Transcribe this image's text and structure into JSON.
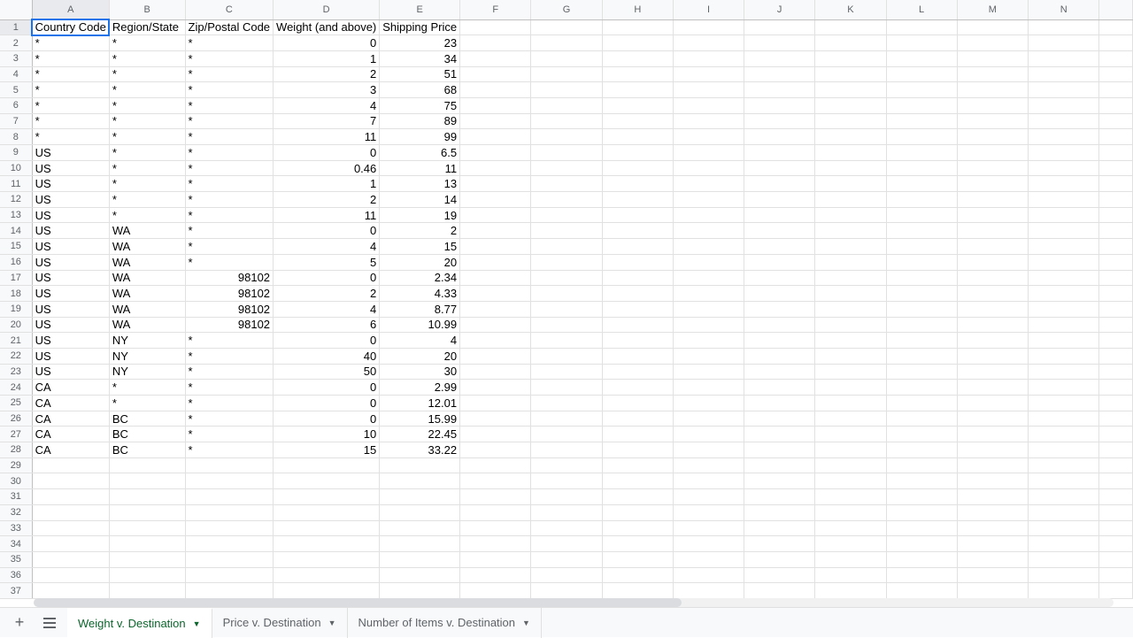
{
  "columns": [
    "A",
    "B",
    "C",
    "D",
    "E",
    "F",
    "G",
    "H",
    "I",
    "J",
    "K",
    "L",
    "M",
    "N"
  ],
  "headers": [
    "Country Code",
    "Region/State",
    "Zip/Postal Code",
    "Weight (and above)",
    "Shipping Price"
  ],
  "activeCell": "A1",
  "rows": [
    [
      "*",
      "*",
      "*",
      "0",
      "23"
    ],
    [
      "*",
      "*",
      "*",
      "1",
      "34"
    ],
    [
      "*",
      "*",
      "*",
      "2",
      "51"
    ],
    [
      "*",
      "*",
      "*",
      "3",
      "68"
    ],
    [
      "*",
      "*",
      "*",
      "4",
      "75"
    ],
    [
      "*",
      "*",
      "*",
      "7",
      "89"
    ],
    [
      "*",
      "*",
      "*",
      "11",
      "99"
    ],
    [
      "US",
      "*",
      "*",
      "0",
      "6.5"
    ],
    [
      "US",
      "*",
      "*",
      "0.46",
      "11"
    ],
    [
      "US",
      "*",
      "*",
      "1",
      "13"
    ],
    [
      "US",
      "*",
      "*",
      "2",
      "14"
    ],
    [
      "US",
      "*",
      "*",
      "11",
      "19"
    ],
    [
      "US",
      "WA",
      "*",
      "0",
      "2"
    ],
    [
      "US",
      "WA",
      "*",
      "4",
      "15"
    ],
    [
      "US",
      "WA",
      "*",
      "5",
      "20"
    ],
    [
      "US",
      "WA",
      "98102",
      "0",
      "2.34"
    ],
    [
      "US",
      "WA",
      "98102",
      "2",
      "4.33"
    ],
    [
      "US",
      "WA",
      "98102",
      "4",
      "8.77"
    ],
    [
      "US",
      "WA",
      "98102",
      "6",
      "10.99"
    ],
    [
      "US",
      "NY",
      "*",
      "0",
      "4"
    ],
    [
      "US",
      "NY",
      "*",
      "40",
      "20"
    ],
    [
      "US",
      "NY",
      "*",
      "50",
      "30"
    ],
    [
      "CA",
      "*",
      "*",
      "0",
      "2.99"
    ],
    [
      "CA",
      "*",
      "*",
      "0",
      "12.01"
    ],
    [
      "CA",
      "BC",
      "*",
      "0",
      "15.99"
    ],
    [
      "CA",
      "BC",
      "*",
      "10",
      "22.45"
    ],
    [
      "CA",
      "BC",
      "*",
      "15",
      "33.22"
    ]
  ],
  "tabs": [
    {
      "label": "Weight v. Destination",
      "active": true
    },
    {
      "label": "Price v. Destination",
      "active": false
    },
    {
      "label": "Number of Items v. Destination",
      "active": false
    }
  ]
}
